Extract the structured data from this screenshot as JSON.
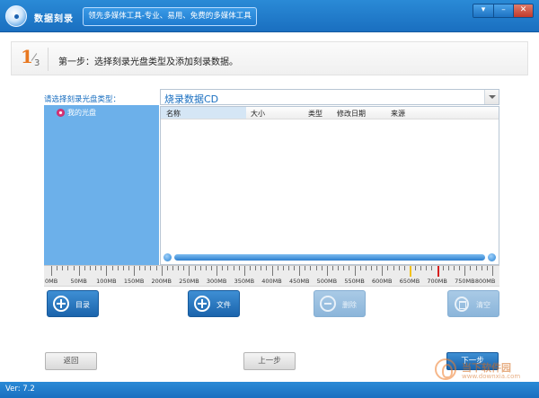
{
  "window": {
    "title": "数据刻录",
    "slogan": "领先多媒体工具-专业、易用、免费的多媒体工具",
    "controls": [
      "▾",
      "–",
      "✕"
    ]
  },
  "step": {
    "current": "1",
    "total": "3",
    "text": "第一步：选择刻录光盘类型及添加刻录数据。"
  },
  "disc": {
    "label": "请选择刻录光盘类型：",
    "selected": "烧录数据CD"
  },
  "tree": {
    "items": [
      {
        "label": "我的光盘"
      }
    ]
  },
  "table": {
    "columns": [
      "名称",
      "大小",
      "类型",
      "修改日期",
      "来源"
    ],
    "rows": []
  },
  "ruler": {
    "labels": [
      "0MB",
      "50MB",
      "100MB",
      "150MB",
      "200MB",
      "250MB",
      "300MB",
      "350MB",
      "400MB",
      "450MB",
      "500MB",
      "550MB",
      "600MB",
      "650MB",
      "700MB",
      "750MB",
      "800MB"
    ],
    "min_mb": 0,
    "max_mb": 800,
    "markers": [
      {
        "value_mb": 650,
        "color": "#f2c21a"
      },
      {
        "value_mb": 700,
        "color": "#d62020"
      }
    ]
  },
  "actions": {
    "directory": "目录",
    "file": "文件",
    "delete": "删除",
    "clear": "清空"
  },
  "nav": {
    "back": "返回",
    "prev": "上一步",
    "next": "下一步"
  },
  "status": {
    "version": "Ver: 7.2"
  },
  "watermark": {
    "line1": "当下软件园",
    "line2": "www.downxia.com"
  }
}
